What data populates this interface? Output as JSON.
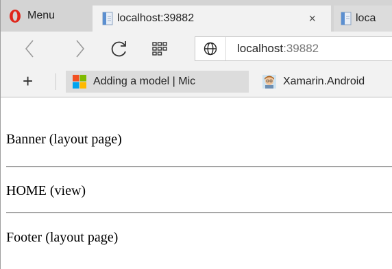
{
  "browser": {
    "menu_label": "Menu",
    "tabs": [
      {
        "title": "localhost:39882",
        "close": "×",
        "active": true
      },
      {
        "title": "loca",
        "active": false
      }
    ],
    "address": {
      "host": "localhost",
      "port": ":39882"
    },
    "bookmarks": [
      {
        "label": "Adding a model | Mic",
        "icon": "microsoft-logo-icon"
      },
      {
        "label": "Xamarin.Android",
        "icon": "avatar-icon"
      }
    ],
    "add_bookmark": "+"
  },
  "page": {
    "banner": "Banner (layout page)",
    "home": "HOME (view)",
    "footer": "Footer (layout page)"
  },
  "colors": {
    "opera_red": "#e0261b",
    "tabstrip": "#d4d4d4",
    "toolbar": "#f2f2f2",
    "ms_red": "#f25022",
    "ms_green": "#7fba00",
    "ms_blue": "#00a4ef",
    "ms_yellow": "#ffb900"
  }
}
